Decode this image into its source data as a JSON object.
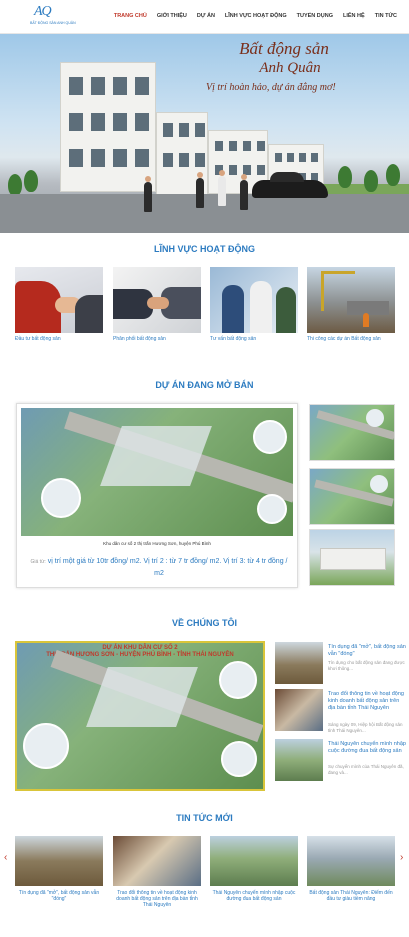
{
  "header": {
    "logo_mark": "AQ",
    "logo_text": "BẤT ĐỘNG SẢN ANH QUÂN",
    "nav": [
      "TRANG CHỦ",
      "GIỚI THIỆU",
      "DỰ ÁN",
      "LĨNH VỰC HOẠT ĐỘNG",
      "TUYỂN DỤNG",
      "LIÊN HỆ",
      "TIN TỨC"
    ],
    "active_color": "#c0392b"
  },
  "hero": {
    "title_line1": "Bất động sản",
    "title_line2": "Anh Quân",
    "slogan": "Vị trí hoàn hảo, dự án đẳng mơ!"
  },
  "activities": {
    "title": "LĨNH VỰC HOẠT ĐỘNG",
    "items": [
      {
        "label": "Đầu tư bất động sản"
      },
      {
        "label": "Phân phối bất động sản"
      },
      {
        "label": "Tư vấn bất động sản"
      },
      {
        "label": "Thi công các dự án Bất động sản"
      }
    ]
  },
  "projects": {
    "title": "DỰ ÁN ĐANG MỞ BÁN",
    "main_caption": "Khu dân cư số 2 thị trấn Hương Sơn, huyện Phú Bình",
    "price_label": "Giá từ:",
    "price_text": "vị trí một giá từ 10tr đồng/ m2. Vị trí 2 : từ 7 tr đồng/ m2. Vị trí 3: từ 4 tr đồng / m2"
  },
  "about": {
    "title": "VỀ CHÚNG TÔI",
    "banner_line1": "DỰ ÁN KHU DÂN CƯ SỐ 2",
    "banner_line2": "THỊ TRẤN HƯƠNG SƠN - HUYỆN PHÚ BÌNH - TỈNH THÁI NGUYÊN",
    "items": [
      {
        "title": "Tín dụng đã \"mở\", bất động sản vẫn \"đóng\"",
        "desc": "Tín dụng cho bất động sản đang được khơi thông..."
      },
      {
        "title": "Trao đổi thông tin về hoạt động kinh doanh bất động sản trên địa bàn tỉnh Thái Nguyên",
        "desc": "Sáng ngày 09, Hiệp hội Bất động sản tỉnh Thái Nguyên..."
      },
      {
        "title": "Thái Nguyên chuyển mình nhập cuộc đường đua bất động sản",
        "desc": "Sự chuyển mình của Thái Nguyên đã, đang và..."
      }
    ]
  },
  "news": {
    "title": "TIN TỨC MỚI",
    "prev_icon": "‹",
    "next_icon": "›",
    "items": [
      {
        "label": "Tín dụng đã \"mở\", bất động sản vẫn \"đóng\""
      },
      {
        "label": "Trao đổi thông tin về hoạt động kinh doanh bất động sản trên địa bàn tỉnh Thái Nguyên"
      },
      {
        "label": "Thái Nguyên chuyển mình nhập cuộc đường đua bất động sản"
      },
      {
        "label": "Bất động sản Thái Nguyên: Điểm đến đầu tư giàu tiềm năng"
      }
    ]
  }
}
